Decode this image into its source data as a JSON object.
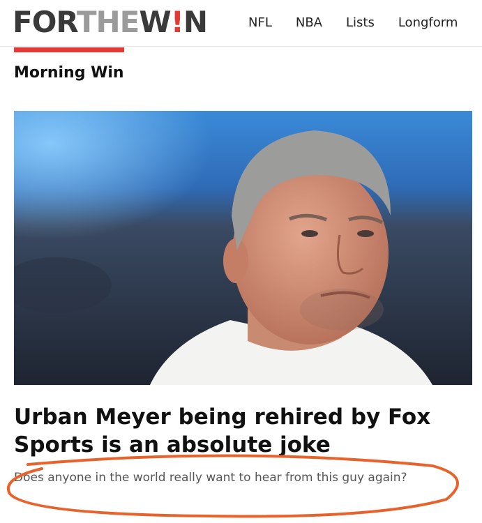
{
  "header": {
    "logo": {
      "part1": "FOR",
      "part2": "THE",
      "part3a": "W",
      "part3b": "!",
      "part3c": "N"
    },
    "nav": [
      "NFL",
      "NBA",
      "Lists",
      "Longform"
    ]
  },
  "section": {
    "label": "Morning Win"
  },
  "article": {
    "headline": "Urban Meyer being rehired by Fox Sports is an absolute joke",
    "dek": "Does anyone in the world really want to hear from this guy again?"
  },
  "colors": {
    "brand_red": "#e53935",
    "annotation_orange": "#e8632c"
  }
}
